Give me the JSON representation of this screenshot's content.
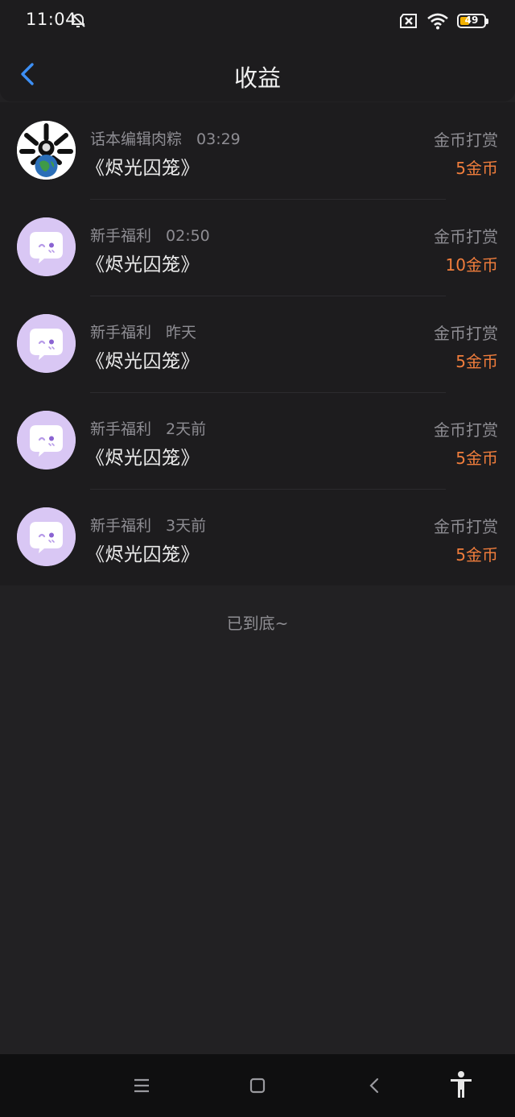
{
  "status_bar": {
    "time": "11:04",
    "battery": "49",
    "icons": [
      "bell-off-icon",
      "sim-x-icon",
      "wifi-icon",
      "battery-icon"
    ]
  },
  "header": {
    "title": "收益",
    "back_icon": "chevron-left-icon"
  },
  "items": [
    {
      "avatar": "user-avatar",
      "source": "话本编辑肉粽",
      "time": "03:29",
      "book": "《烬光囚笼》",
      "type": "金币打赏",
      "amount": "5金币"
    },
    {
      "avatar": "ghost-mascot-avatar",
      "source": "新手福利",
      "time": "02:50",
      "book": "《烬光囚笼》",
      "type": "金币打赏",
      "amount": "10金币"
    },
    {
      "avatar": "ghost-mascot-avatar",
      "source": "新手福利",
      "time": "昨天",
      "book": "《烬光囚笼》",
      "type": "金币打赏",
      "amount": "5金币"
    },
    {
      "avatar": "ghost-mascot-avatar",
      "source": "新手福利",
      "time": "2天前",
      "book": "《烬光囚笼》",
      "type": "金币打赏",
      "amount": "5金币"
    },
    {
      "avatar": "ghost-mascot-avatar",
      "source": "新手福利",
      "time": "3天前",
      "book": "《烬光囚笼》",
      "type": "金币打赏",
      "amount": "5金币"
    }
  ],
  "footer": {
    "end_text": "已到底~"
  },
  "system_nav": {
    "buttons": [
      "menu-icon",
      "home-icon",
      "back-icon",
      "accessibility-icon"
    ]
  },
  "colors": {
    "background": "#222123",
    "card": "#1d1c1e",
    "accent_orange": "#f07d3c",
    "back_blue": "#3d8ff5",
    "avatar_purple": "#d9c7f4"
  }
}
